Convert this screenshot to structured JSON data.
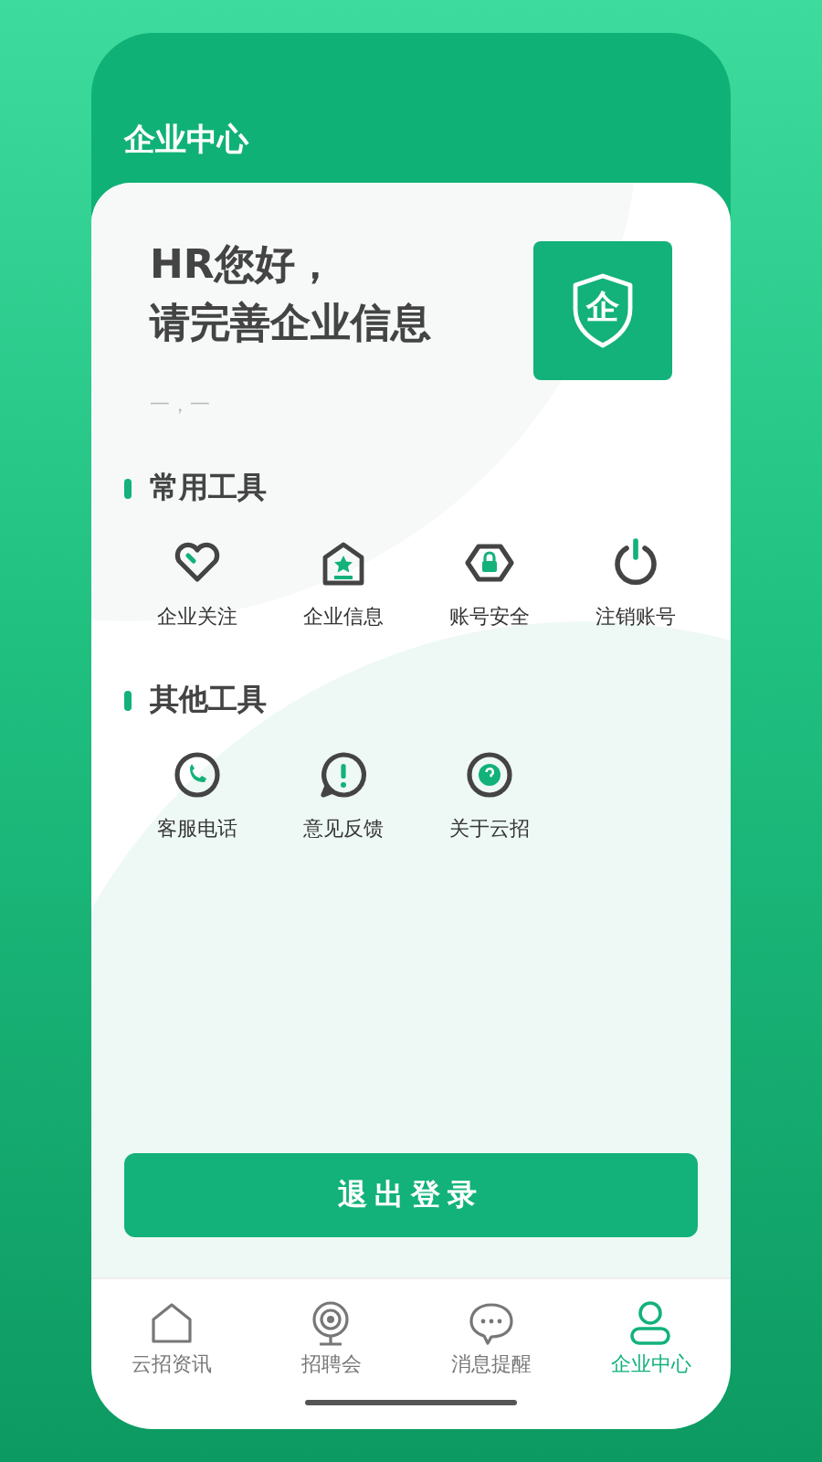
{
  "header": {
    "title": "企业中心"
  },
  "greeting": {
    "line1": "HR您好，",
    "line2": "请完善企业信息",
    "subtitle": "一，一",
    "badge_glyph": "企"
  },
  "sections": [
    {
      "title": "常用工具",
      "tools": [
        {
          "label": "企业关注",
          "kind": "heart"
        },
        {
          "label": "企业信息",
          "kind": "house"
        },
        {
          "label": "账号安全",
          "kind": "lock"
        },
        {
          "label": "注销账号",
          "kind": "power"
        }
      ]
    },
    {
      "title": "其他工具",
      "tools": [
        {
          "label": "客服电话",
          "kind": "phone"
        },
        {
          "label": "意见反馈",
          "kind": "alert"
        },
        {
          "label": "关于云招",
          "kind": "help"
        }
      ]
    }
  ],
  "logout_button": "退出登录",
  "tab_bar": [
    {
      "label": "云招资讯",
      "kind": "home",
      "selected": false
    },
    {
      "label": "招聘会",
      "kind": "camera",
      "selected": false
    },
    {
      "label": "消息提醒",
      "kind": "chat",
      "selected": false
    },
    {
      "label": "企业中心",
      "kind": "user",
      "selected": true
    }
  ]
}
